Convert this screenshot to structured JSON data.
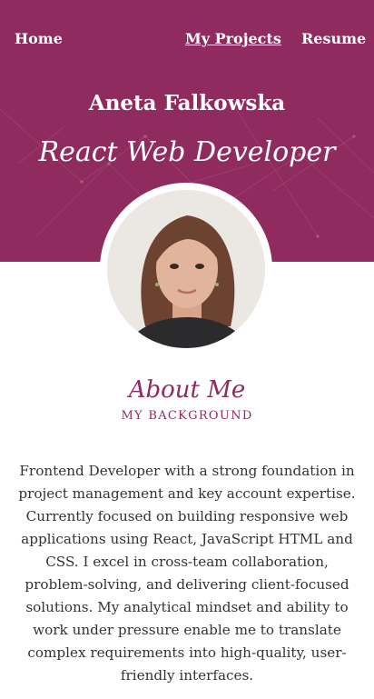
{
  "nav": {
    "home_label": "Home",
    "projects_label": "My Projects",
    "resume_label": "Resume"
  },
  "hero": {
    "name": "Aneta Falkowska",
    "role": "React Web Developer"
  },
  "about": {
    "title": "About Me",
    "subtitle": "MY BACKGROUND",
    "text": "Frontend Developer with a strong foundation in project management and key account expertise. Currently focused on building responsive web applications using React, JavaScript HTML and CSS. I excel in cross-team collaboration, problem-solving, and delivering client-focused solutions. My analytical mindset and ability to work under pressure enable me to translate complex requirements into high-quality, user-friendly interfaces."
  },
  "colors": {
    "brand": "#8f2b5f",
    "text": "#333333",
    "background": "#ffffff"
  }
}
